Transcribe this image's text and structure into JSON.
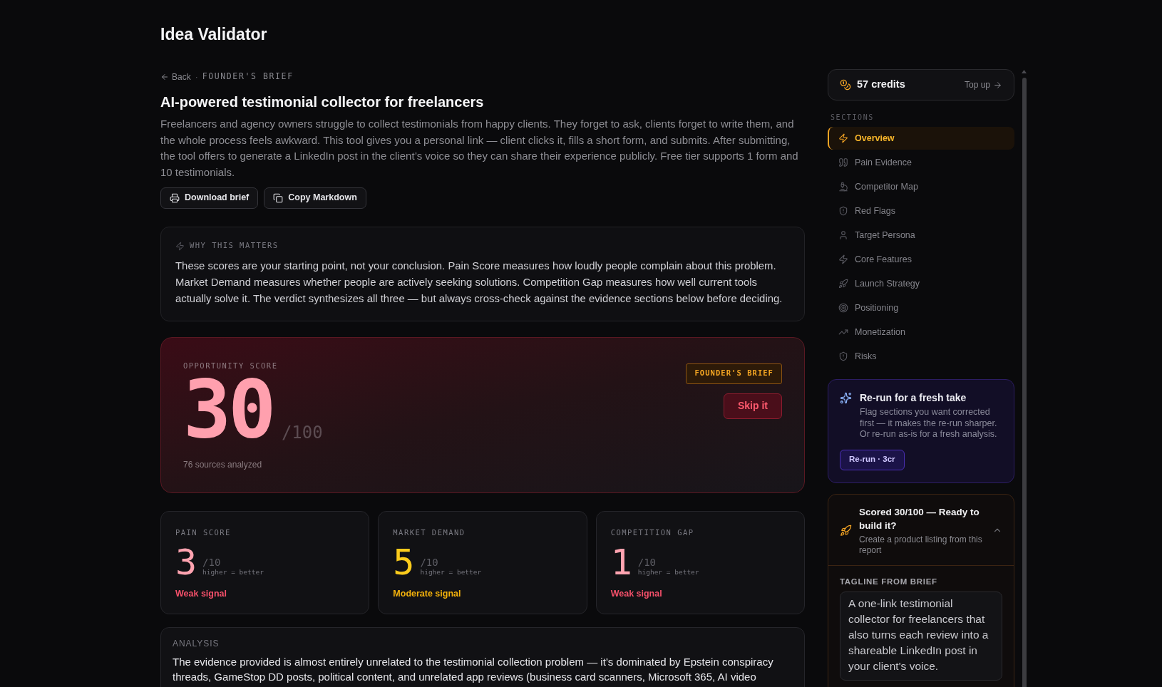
{
  "app": {
    "title": "Idea Validator"
  },
  "breadcrumb": {
    "back": "Back",
    "separator": "·",
    "section": "FOUNDER'S BRIEF"
  },
  "idea": {
    "title": "AI-powered testimonial collector for freelancers",
    "description": "Freelancers and agency owners struggle to collect testimonials from happy clients. They forget to ask, clients forget to write them, and the whole process feels awkward. This tool gives you a personal link — client clicks it, fills a short form, and submits. After submitting, the tool offers to generate a LinkedIn post in the client’s voice so they can share their experience publicly. Free tier supports 1 form and 10 testimonials."
  },
  "actions": [
    {
      "label": "Download brief"
    },
    {
      "label": "Copy Markdown"
    }
  ],
  "why_this_matters": {
    "heading": "WHY THIS MATTERS",
    "text": "These scores are your starting point, not your conclusion. Pain Score measures how loudly people complain about this problem. Market Demand measures whether people are actively seeking solutions. Competition Gap measures how well current tools actually solve it. The verdict synthesizes all three — but always cross-check against the evidence sections below before deciding."
  },
  "opportunity": {
    "label": "OPPORTUNITY SCORE",
    "score": "30",
    "max": "/100",
    "sources": "76 sources analyzed",
    "badge": "FOUNDER'S BRIEF",
    "verdict": "Skip it"
  },
  "scores": [
    {
      "label": "PAIN SCORE",
      "value": "3",
      "max": "/10",
      "hint": "higher = better",
      "signal": "Weak signal",
      "kind": "weak"
    },
    {
      "label": "MARKET DEMAND",
      "value": "5",
      "max": "/10",
      "hint": "higher = better",
      "signal": "Moderate signal",
      "kind": "moderate"
    },
    {
      "label": "COMPETITION GAP",
      "value": "1",
      "max": "/10",
      "hint": "higher = better",
      "signal": "Weak signal",
      "kind": "weak"
    }
  ],
  "analysis": {
    "heading": "ANALYSIS",
    "text": "The evidence provided is almost entirely unrelated to the testimonial collection problem — it’s dominated by Epstein conspiracy threads, GameStop DD posts, political content, and unrelated app reviews (business card scanners, Microsoft 365, AI video"
  },
  "sidebar": {
    "credits": {
      "amount": "57 credits",
      "action": "Top up"
    },
    "sections_label": "SECTIONS",
    "sections": [
      {
        "label": "Overview",
        "selected": true
      },
      {
        "label": "Pain Evidence",
        "selected": false
      },
      {
        "label": "Competitor Map",
        "selected": false
      },
      {
        "label": "Red Flags",
        "selected": false
      },
      {
        "label": "Target Persona",
        "selected": false
      },
      {
        "label": "Core Features",
        "selected": false
      },
      {
        "label": "Launch Strategy",
        "selected": false
      },
      {
        "label": "Positioning",
        "selected": false
      },
      {
        "label": "Monetization",
        "selected": false
      },
      {
        "label": "Risks",
        "selected": false
      }
    ],
    "rerun": {
      "title": "Re-run for a fresh take",
      "text": "Flag sections you want corrected first — it makes the re-run sharper. Or re-run as-is for a fresh analysis.",
      "button": "Re-run · 3cr"
    },
    "build": {
      "title": "Scored 30/100 — Ready to build it?",
      "subtitle": "Create a product listing from this report",
      "expanded": true,
      "tagline_label": "TAGLINE FROM BRIEF",
      "tagline": "A one-link testimonial collector for freelancers that also turns each review into a shareable LinkedIn post in your client's voice."
    }
  }
}
